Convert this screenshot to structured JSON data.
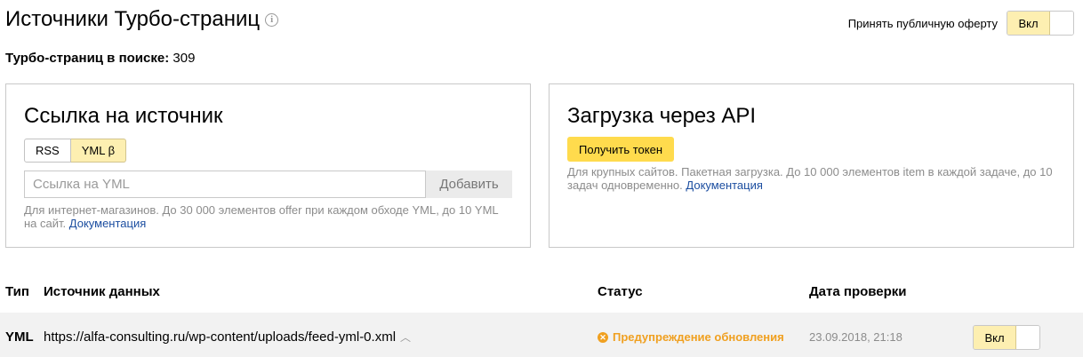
{
  "header": {
    "title": "Источники Турбо-страниц",
    "info_icon": "info-icon",
    "offer_label": "Принять публичную оферту",
    "offer_toggle_label": "Вкл"
  },
  "summary": {
    "label": "Турбо-страниц в поиске:",
    "value": "309"
  },
  "source_card": {
    "title": "Ссылка на источник",
    "tabs": [
      {
        "label": "RSS",
        "active": false
      },
      {
        "label": "YML β",
        "active": true
      }
    ],
    "input_placeholder": "Ссылка на YML",
    "input_value": "",
    "add_label": "Добавить",
    "hint": "Для интернет-магазинов. До 30 000 элементов offer при каждом обходе YML, до 10 YML на сайт.",
    "hint_link": "Документация"
  },
  "api_card": {
    "title": "Загрузка через API",
    "token_label": "Получить токен",
    "hint": "Для крупных сайтов. Пакетная загрузка. До 10 000 элементов item в каждой задаче, до 10 задач одновременно.",
    "hint_link": "Документация"
  },
  "table": {
    "columns": {
      "type": "Тип",
      "source": "Источник данных",
      "status": "Статус",
      "date": "Дата проверки"
    },
    "rows": [
      {
        "type": "YML",
        "source": "https://alfa-consulting.ru/wp-content/uploads/feed-yml-0.xml",
        "status": "Предупреждение обновления",
        "date": "23.09.2018, 21:18",
        "toggle_label": "Вкл"
      }
    ]
  },
  "colors": {
    "accent_yellow": "#ffdb4d",
    "toggle_on": "#fdefb1",
    "warning": "#f0a020",
    "link": "#1c4ea0"
  }
}
